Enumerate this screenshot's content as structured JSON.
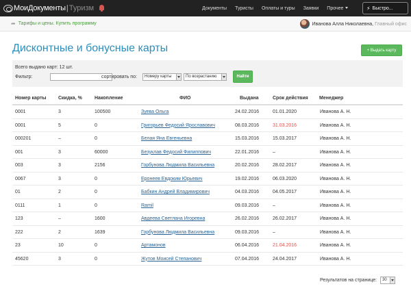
{
  "navbar": {
    "brand_main": "МоиДокументы",
    "brand_sep": "|",
    "brand_sub": "Туризм",
    "links": [
      "Документы",
      "Туристы",
      "Оплаты и туры",
      "Заявки",
      "Прочее"
    ],
    "quick_label": "Быстро..."
  },
  "subbar": {
    "tariff_link": "Тарифы и цены. Купить программу",
    "user_name": "Иванова Алла Николаевна,",
    "user_office": "Главный офис"
  },
  "page": {
    "title": "Дисконтные и бонусные карты",
    "issue_button": "+ Выдать карту"
  },
  "filter": {
    "total_text": "Всего выдано карт: 12 шт.",
    "filter_label": "Фильтр:",
    "filter_value": "",
    "sort_label": "сортировать по:",
    "sort_field": "Номеру карты",
    "sort_order": "По возрастанию",
    "find_button": "Найти"
  },
  "table": {
    "headers": [
      "Номер карты",
      "Скидка, %",
      "Накопление",
      "ФИО",
      "Выдана",
      "Срок действия",
      "Менеджер"
    ],
    "rows": [
      {
        "number": "0001",
        "discount": "3",
        "accum": "100500",
        "name": "Зуева Ольга",
        "issued": "24.02.2016",
        "valid": "01.01.2020",
        "manager": "Иванова А. Н.",
        "expired": false
      },
      {
        "number": "0001",
        "discount": "5",
        "accum": "0",
        "name": "Григорьев Федосий Ярославович",
        "issued": "08.03.2016",
        "valid": "31.03.2016",
        "manager": "Иванова А. Н.",
        "expired": true
      },
      {
        "number": "000201",
        "discount": "–",
        "accum": "0",
        "name": "Белая Яна Евгеньевна",
        "issued": "15.03.2016",
        "valid": "15.03.2017",
        "manager": "Иванова А. Н.",
        "expired": false
      },
      {
        "number": "001",
        "discount": "3",
        "accum": "60000",
        "name": "Безуклав Федосий Филиппович",
        "issued": "22.01.2016",
        "valid": "–",
        "manager": "Иванова А. Н.",
        "expired": false
      },
      {
        "number": "003",
        "discount": "3",
        "accum": "2156",
        "name": "Горбунова Людмила Васильевна",
        "issued": "20.02.2016",
        "valid": "28.02.2017",
        "manager": "Иванова А. Н.",
        "expired": false
      },
      {
        "number": "0067",
        "discount": "3",
        "accum": "0",
        "name": "Еронеев Евдоким Юрьевич",
        "issued": "19.02.2016",
        "valid": "06.03.2020",
        "manager": "Иванова А. Н.",
        "expired": false
      },
      {
        "number": "01",
        "discount": "2",
        "accum": "0",
        "name": "Бабкин Андрей Владимирович",
        "issued": "04.03.2016",
        "valid": "04.05.2017",
        "manager": "Иванова А. Н.",
        "expired": false
      },
      {
        "number": "0111",
        "discount": "1",
        "accum": "0",
        "name": "Ramil",
        "issued": "09.03.2016",
        "valid": "–",
        "manager": "Иванова А. Н.",
        "expired": false
      },
      {
        "number": "123",
        "discount": "–",
        "accum": "1600",
        "name": "Авдеева Светлана Игоревна",
        "issued": "26.02.2016",
        "valid": "26.02.2017",
        "manager": "Иванова А. Н.",
        "expired": false
      },
      {
        "number": "222",
        "discount": "2",
        "accum": "1639",
        "name": "Горбунова Людмила Васильевна",
        "issued": "09.03.2016",
        "valid": "–",
        "manager": "Иванова А. Н.",
        "expired": false
      },
      {
        "number": "23",
        "discount": "10",
        "accum": "0",
        "name": "Артамонов",
        "issued": "06.04.2016",
        "valid": "21.04.2016",
        "manager": "Иванова А. Н.",
        "expired": true
      },
      {
        "number": "45620",
        "discount": "3",
        "accum": "0",
        "name": "Жутов Моисей Степанович",
        "issued": "07.04.2016",
        "valid": "24.04.2017",
        "manager": "Иванова А. Н.",
        "expired": false
      }
    ]
  },
  "footer": {
    "per_page_label": "Результатов на странице:",
    "per_page_value": "30"
  },
  "colors": {
    "navbar": "#222222",
    "title": "#2a8fbd",
    "green_button": "#5cb85c",
    "link": "#2a6496",
    "expired": "#d9534f"
  }
}
